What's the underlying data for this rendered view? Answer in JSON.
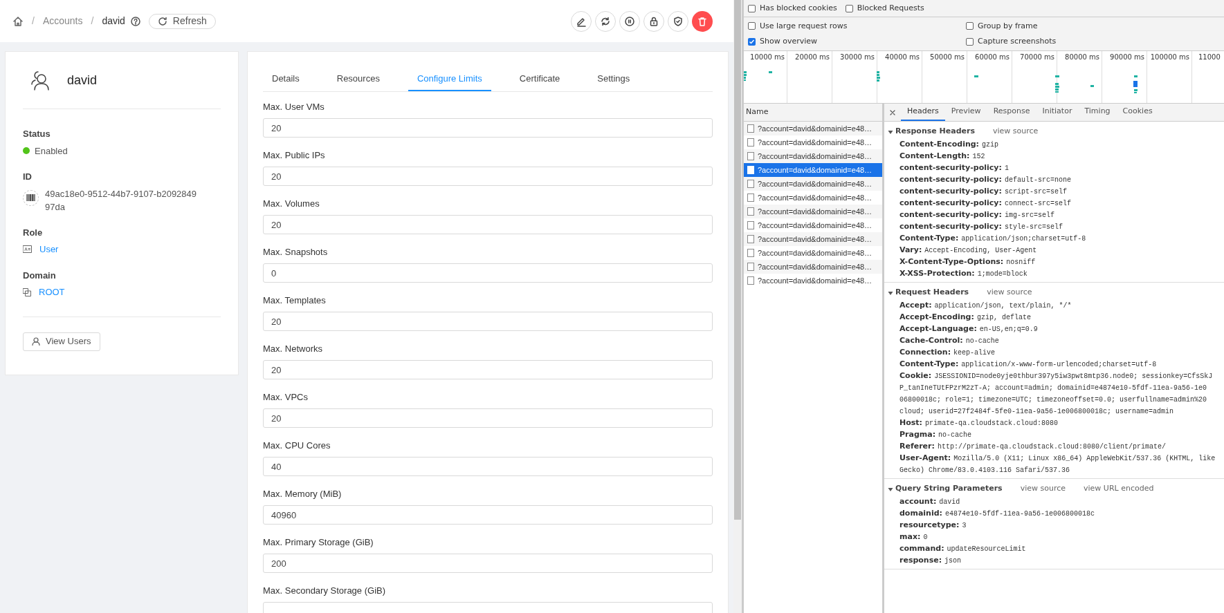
{
  "breadcrumb": [
    {
      "label": "/",
      "kind": "separator"
    },
    {
      "label": "Accounts",
      "kind": "link"
    },
    {
      "label": "/",
      "kind": "separator"
    },
    {
      "label": "david",
      "kind": "current"
    }
  ],
  "refresh_button": "Refresh",
  "account": {
    "name": "david",
    "details": [
      {
        "label": "Status",
        "value": "Enabled",
        "kind": "status"
      },
      {
        "label": "ID",
        "value": "49ac18e0-9512-44b7-9107-b209284997da",
        "kind": "id"
      },
      {
        "label": "Role",
        "value": "User",
        "kind": "role"
      },
      {
        "label": "Domain",
        "value": "ROOT",
        "kind": "domain"
      }
    ],
    "view_users_button": "View Users"
  },
  "tabs": [
    {
      "label": "Details",
      "selected": false
    },
    {
      "label": "Resources",
      "selected": false
    },
    {
      "label": "Configure Limits",
      "selected": true
    },
    {
      "label": "Certificate",
      "selected": false
    },
    {
      "label": "Settings",
      "selected": false
    }
  ],
  "limits": [
    {
      "label": "Max. User VMs",
      "value": "20"
    },
    {
      "label": "Max. Public IPs",
      "value": "20"
    },
    {
      "label": "Max. Volumes",
      "value": "20"
    },
    {
      "label": "Max. Snapshots",
      "value": "0"
    },
    {
      "label": "Max. Templates",
      "value": "20"
    },
    {
      "label": "Max. Networks",
      "value": "20"
    },
    {
      "label": "Max. VPCs",
      "value": "20"
    },
    {
      "label": "Max. CPU Cores",
      "value": "40"
    },
    {
      "label": "Max. Memory (MiB)",
      "value": "40960"
    },
    {
      "label": "Max. Primary Storage (GiB)",
      "value": "200"
    },
    {
      "label": "Max. Secondary Storage (GiB)"
    }
  ],
  "devtools": {
    "filters": [
      {
        "label": "Has blocked cookies",
        "checked": false
      },
      {
        "label": "Blocked Requests",
        "checked": false
      }
    ],
    "options": [
      {
        "label": "Use large request rows",
        "checked": false
      },
      {
        "label": "Group by frame",
        "checked": false
      },
      {
        "label": "Show overview",
        "checked": true
      },
      {
        "label": "Capture screenshots",
        "checked": false
      }
    ],
    "overview_ticks": [
      "10000 ms",
      "20000 ms",
      "30000 ms",
      "40000 ms",
      "50000 ms",
      "60000 ms",
      "70000 ms",
      "80000 ms",
      "90000 ms",
      "100000 ms",
      "11000"
    ],
    "requests": {
      "column": "Name",
      "rows": [
        {
          "name": "?account=david&domainid=e48…",
          "selected": false
        },
        {
          "name": "?account=david&domainid=e48…",
          "selected": false
        },
        {
          "name": "?account=david&domainid=e48…",
          "selected": false
        },
        {
          "name": "?account=david&domainid=e48…",
          "selected": true
        },
        {
          "name": "?account=david&domainid=e48…",
          "selected": false
        },
        {
          "name": "?account=david&domainid=e48…",
          "selected": false
        },
        {
          "name": "?account=david&domainid=e48…",
          "selected": false
        },
        {
          "name": "?account=david&domainid=e48…",
          "selected": false
        },
        {
          "name": "?account=david&domainid=e48…",
          "selected": false
        },
        {
          "name": "?account=david&domainid=e48…",
          "selected": false
        },
        {
          "name": "?account=david&domainid=e48…",
          "selected": false
        },
        {
          "name": "?account=david&domainid=e48…",
          "selected": false
        }
      ]
    },
    "detail_tabs": [
      {
        "label": "Headers",
        "selected": true
      },
      {
        "label": "Preview",
        "selected": false
      },
      {
        "label": "Response",
        "selected": false
      },
      {
        "label": "Initiator",
        "selected": false
      },
      {
        "label": "Timing",
        "selected": false
      },
      {
        "label": "Cookies",
        "selected": false
      }
    ],
    "sections": [
      {
        "title": "Response Headers",
        "links": [
          "view source"
        ],
        "entries": [
          {
            "name": "Content-Encoding:",
            "value_lines": [
              "gzip"
            ]
          },
          {
            "name": "Content-Length:",
            "value_lines": [
              "152"
            ]
          },
          {
            "name": "content-security-policy:",
            "value_lines": [
              "1"
            ]
          },
          {
            "name": "content-security-policy:",
            "value_lines": [
              "default-src=none"
            ]
          },
          {
            "name": "content-security-policy:",
            "value_lines": [
              "script-src=self"
            ]
          },
          {
            "name": "content-security-policy:",
            "value_lines": [
              "connect-src=self"
            ]
          },
          {
            "name": "content-security-policy:",
            "value_lines": [
              "img-src=self"
            ]
          },
          {
            "name": "content-security-policy:",
            "value_lines": [
              "style-src=self"
            ]
          },
          {
            "name": "Content-Type:",
            "value_lines": [
              "application/json;charset=utf-8"
            ]
          },
          {
            "name": "Vary:",
            "value_lines": [
              "Accept-Encoding, User-Agent"
            ]
          },
          {
            "name": "X-Content-Type-Options:",
            "value_lines": [
              "nosniff"
            ]
          },
          {
            "name": "X-XSS-Protection:",
            "value_lines": [
              "1;mode=block"
            ]
          }
        ]
      },
      {
        "title": "Request Headers",
        "links": [
          "view source"
        ],
        "entries": [
          {
            "name": "Accept:",
            "value_lines": [
              "application/json, text/plain, */*"
            ]
          },
          {
            "name": "Accept-Encoding:",
            "value_lines": [
              "gzip, deflate"
            ]
          },
          {
            "name": "Accept-Language:",
            "value_lines": [
              "en-US,en;q=0.9"
            ]
          },
          {
            "name": "Cache-Control:",
            "value_lines": [
              "no-cache"
            ]
          },
          {
            "name": "Connection:",
            "value_lines": [
              "keep-alive"
            ]
          },
          {
            "name": "Content-Type:",
            "value_lines": [
              "application/x-www-form-urlencoded;charset=utf-8"
            ]
          },
          {
            "name": "Cookie:",
            "value_lines": [
              "JSESSIONID=node0yje0thbur397y5iw3pwt8mtp36.node0; sessionkey=CfsSkJ",
              "P_tanIneTUtFPzrM2zT-A; account=admin; domainid=e4874e10-5fdf-11ea-9a56-1e0",
              "06800018c; role=1; timezone=UTC; timezoneoffset=0.0; userfullname=admin%20",
              "cloud; userid=27f2484f-5fe0-11ea-9a56-1e006800018c; username=admin"
            ]
          },
          {
            "name": "Host:",
            "value_lines": [
              "primate-qa.cloudstack.cloud:8080"
            ]
          },
          {
            "name": "Pragma:",
            "value_lines": [
              "no-cache"
            ]
          },
          {
            "name": "Referer:",
            "value_lines": [
              "http://primate-qa.cloudstack.cloud:8080/client/primate/"
            ]
          },
          {
            "name": "User-Agent:",
            "value_lines": [
              "Mozilla/5.0 (X11; Linux x86_64) AppleWebKit/537.36 (KHTML, like",
              "Gecko) Chrome/83.0.4103.116 Safari/537.36"
            ]
          }
        ]
      },
      {
        "title": "Query String Parameters",
        "links": [
          "view source",
          "view URL encoded"
        ],
        "entries": [
          {
            "name": "account:",
            "value_lines": [
              "david"
            ]
          },
          {
            "name": "domainid:",
            "value_lines": [
              "e4874e10-5fdf-11ea-9a56-1e006800018c"
            ]
          },
          {
            "name": "resourcetype:",
            "value_lines": [
              "3"
            ]
          },
          {
            "name": "max:",
            "value_lines": [
              "0"
            ]
          },
          {
            "name": "command:",
            "value_lines": [
              "updateResourceLimit"
            ]
          },
          {
            "name": "response:",
            "value_lines": [
              "json"
            ]
          }
        ]
      }
    ]
  }
}
